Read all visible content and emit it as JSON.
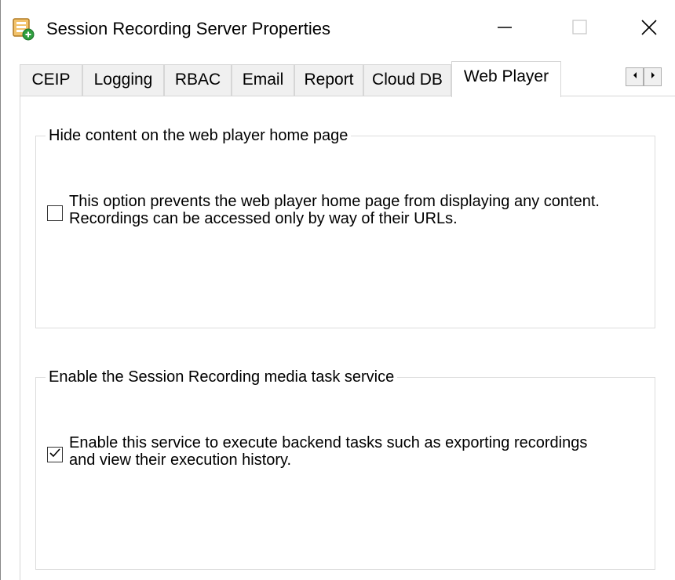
{
  "window": {
    "title": "Session Recording Server Properties"
  },
  "tabs": [
    {
      "label": "CEIP",
      "active": false
    },
    {
      "label": "Logging",
      "active": false
    },
    {
      "label": "RBAC",
      "active": false
    },
    {
      "label": "Email",
      "active": false
    },
    {
      "label": "Report",
      "active": false
    },
    {
      "label": "Cloud DB",
      "active": false
    },
    {
      "label": "Web Player",
      "active": true
    }
  ],
  "groups": {
    "hide_content": {
      "legend": "Hide content on the web player home page",
      "checkbox_label": "This option prevents the web player home page from displaying any content. Recordings can be accessed only by way of their URLs.",
      "checked": false
    },
    "media_task": {
      "legend": "Enable the Session Recording media task service",
      "checkbox_label": "Enable this service to execute backend tasks such as exporting recordings and view their execution history.",
      "checked": true
    }
  },
  "icons": {
    "app": "server-properties-icon",
    "minimize": "minimize-icon",
    "maximize": "maximize-icon",
    "close": "close-icon",
    "tab_scroll_left": "arrow-left-icon",
    "tab_scroll_right": "arrow-right-icon",
    "check": "checkmark-icon"
  },
  "colors": {
    "app_icon_orange": "#e8a33a",
    "app_icon_green": "#2e9e3e"
  }
}
